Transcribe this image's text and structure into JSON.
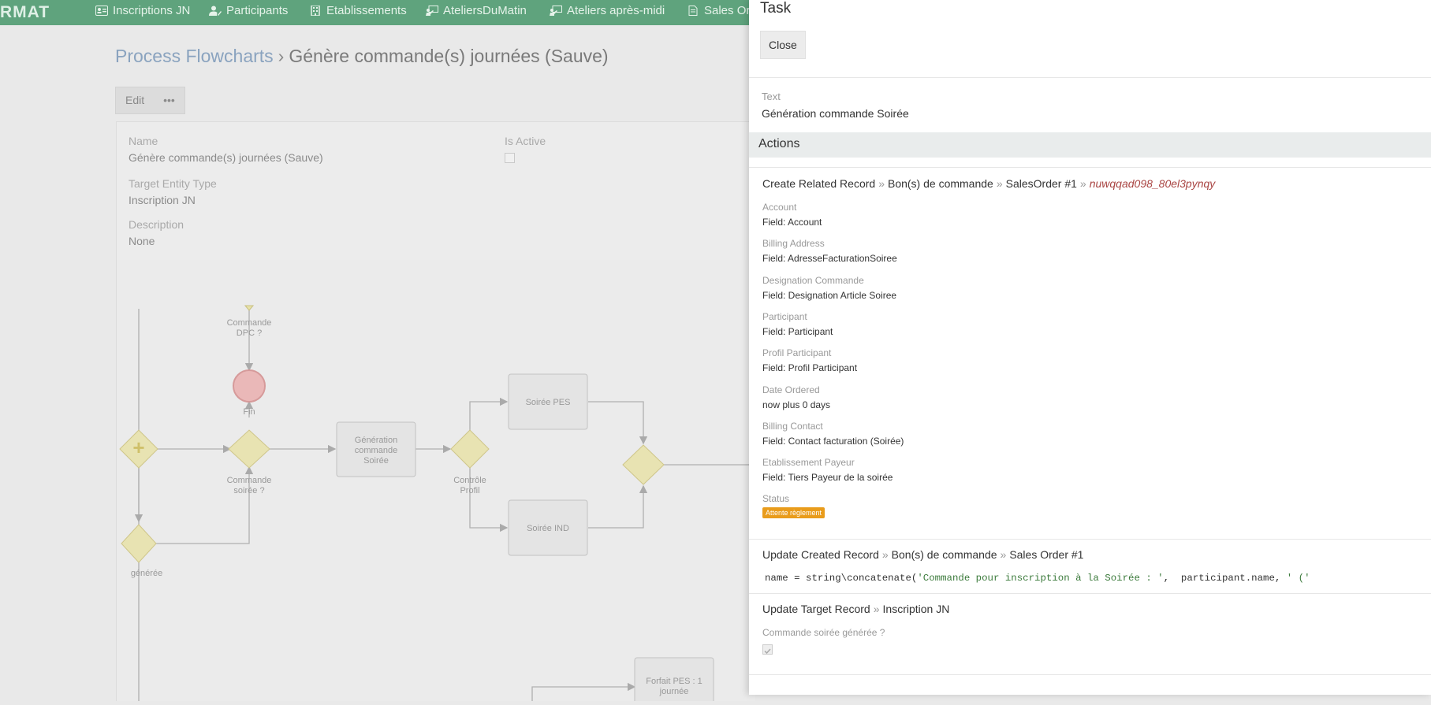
{
  "nav": {
    "brand": "RMAT",
    "items": [
      {
        "label": "Inscriptions JN",
        "icon": "id-card-icon"
      },
      {
        "label": "Participants",
        "icon": "user-edit-icon"
      },
      {
        "label": "Etablissements",
        "icon": "building-icon"
      },
      {
        "label": "AteliersDuMatin",
        "icon": "presentation-icon"
      },
      {
        "label": "Ateliers après-midi",
        "icon": "presentation-icon"
      },
      {
        "label": "Sales Or",
        "icon": "document-icon"
      }
    ]
  },
  "breadcrumb": {
    "parent": "Process Flowcharts",
    "separator": "›",
    "current": "Génère commande(s) journées (Sauve)"
  },
  "record_buttons": {
    "edit": "Edit",
    "more": "•••"
  },
  "record": {
    "name_label": "Name",
    "name_value": "Génère commande(s) journées (Sauve)",
    "is_active_label": "Is Active",
    "target_label": "Target Entity Type",
    "target_value": "Inscription JN",
    "description_label": "Description",
    "description_value": "None"
  },
  "flowchart": {
    "commande_dpc": "Commande DPC ?",
    "fin": "Fin",
    "commande_soiree": "Commande soirée ?",
    "generation": "Génération commande Soirée",
    "controle": "Contrôle Profil",
    "soiree_pes": "Soirée PES",
    "soiree_ind": "Soirée IND",
    "generee": "générée",
    "forfait": "Forfait PES : 1 journée"
  },
  "task_panel": {
    "title": "Task",
    "close": "Close",
    "text_label": "Text",
    "text_value": "Génération commande Soirée",
    "actions_title": "Actions",
    "action1": {
      "type": "Create Related Record",
      "link": "Bon(s) de commande",
      "target": "SalesOrder #1",
      "id": "nuwqqad098_80el3pynqy",
      "fields": [
        {
          "label": "Account",
          "value": "Field: Account"
        },
        {
          "label": "Billing Address",
          "value": "Field: AdresseFacturationSoiree"
        },
        {
          "label": "Designation Commande",
          "value": "Field: Designation Article Soiree"
        },
        {
          "label": "Participant",
          "value": "Field: Participant"
        },
        {
          "label": "Profil Participant",
          "value": "Field: Profil Participant"
        },
        {
          "label": "Date Ordered",
          "value": "now plus 0 days"
        },
        {
          "label": "Billing Contact",
          "value": "Field: Contact facturation (Soirée)"
        },
        {
          "label": "Etablissement Payeur",
          "value": "Field: Tiers Payeur de la soirée"
        }
      ],
      "status_label": "Status",
      "status_value": "Attente règlement"
    },
    "action2": {
      "type": "Update Created Record",
      "link": "Bon(s) de commande",
      "target": "Sales Order #1",
      "code_prefix": "name = string\\concatenate(",
      "code_str1": "'Commande pour inscription à la Soirée : '",
      "code_mid": ",  participant.name, ",
      "code_str2": "' ('"
    },
    "action3": {
      "type": "Update Target Record",
      "target": "Inscription JN",
      "field_label": "Commande soirée générée ?"
    }
  },
  "colors": {
    "nav": "#5fa37d",
    "badge": "#e99c1b",
    "id_link": "#a94442"
  }
}
